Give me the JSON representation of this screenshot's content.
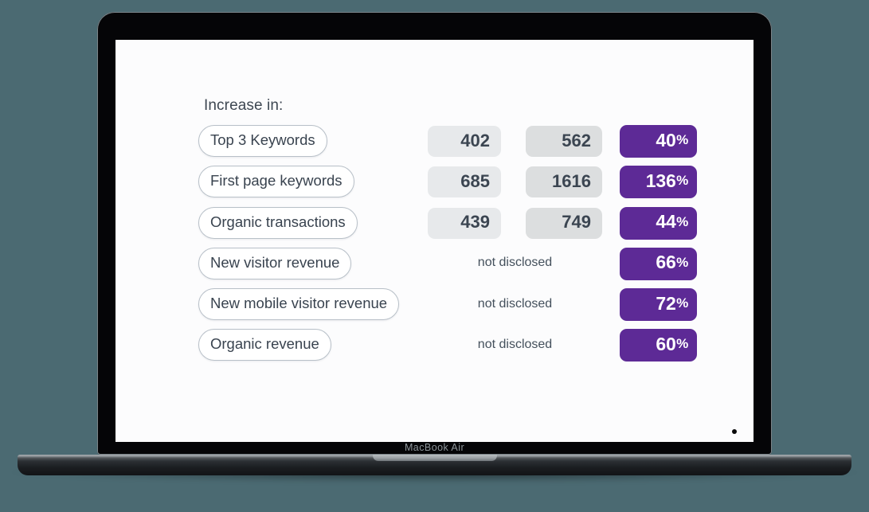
{
  "device": {
    "model_label": "MacBook Air"
  },
  "slide": {
    "heading": "Increase in:",
    "colors": {
      "background": "#4b6a72",
      "screen": "#fcfcfd",
      "accent_purple": "#5d2a96",
      "chip_light": "#e7e9eb",
      "chip_dark": "#dcdedf",
      "text_dark": "#39434f",
      "pill_border": "#b8c0c8"
    },
    "not_disclosed_label": "not disclosed",
    "percent_sign": "%",
    "rows": [
      {
        "label": "Top 3 Keywords",
        "before": "402",
        "after": "562",
        "delta": "40",
        "disclosed": true
      },
      {
        "label": "First page keywords",
        "before": "685",
        "after": "1616",
        "delta": "136",
        "disclosed": true
      },
      {
        "label": "Organic transactions",
        "before": "439",
        "after": "749",
        "delta": "44",
        "disclosed": true
      },
      {
        "label": "New visitor revenue",
        "before": "not disclosed",
        "after": "",
        "delta": "66",
        "disclosed": false
      },
      {
        "label": "New mobile visitor revenue",
        "before": "not disclosed",
        "after": "",
        "delta": "72",
        "disclosed": false
      },
      {
        "label": "Organic revenue",
        "before": "not disclosed",
        "after": "",
        "delta": "60",
        "disclosed": false
      }
    ]
  }
}
